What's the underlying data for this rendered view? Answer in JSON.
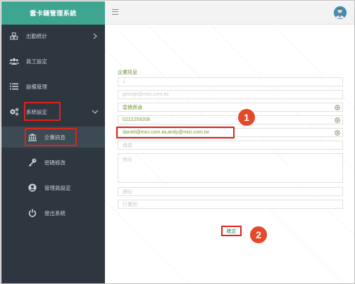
{
  "app": {
    "title": "雲卡鏈管理系統"
  },
  "sidebar": {
    "items": [
      {
        "label": "出勤統計",
        "icon": "cubes-icon"
      },
      {
        "label": "員工設定",
        "icon": "users-icon"
      },
      {
        "label": "設備管理",
        "icon": "list-icon"
      },
      {
        "label": "系統設定",
        "icon": "gears-icon"
      }
    ],
    "sub_items": [
      {
        "label": "企業訊息",
        "icon": "bank-icon"
      },
      {
        "label": "密碼修改",
        "icon": "key-icon"
      },
      {
        "label": "管理員設定",
        "icon": "user-circle-icon"
      },
      {
        "label": "登出系統",
        "icon": "power-icon"
      }
    ]
  },
  "form": {
    "section_title": "企業訊息",
    "id_value": "1",
    "account_email": "george@mici.com.tw",
    "company_name": "雲積資通",
    "phone": "0222259208",
    "notify_emails": "daniel@mici.com.tw,andy@mici.com.tw",
    "fax_placeholder": "傳真",
    "address_placeholder": "地址",
    "website_placeholder": "網址",
    "industry_placeholder": "行業別",
    "confirm_label": "確定"
  },
  "annotations": {
    "step1": "1",
    "step2": "2"
  },
  "colors": {
    "brand": "#3ea690",
    "sidebar": "#2e3640",
    "highlight": "#e0221b",
    "badge": "#e24a2a"
  }
}
